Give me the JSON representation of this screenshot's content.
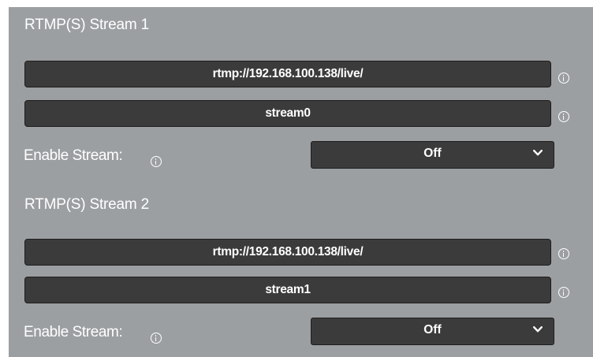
{
  "streams": [
    {
      "title": "RTMP(S) Stream 1",
      "url_value": "rtmp://192.168.100.138/live/",
      "key_value": "stream0",
      "enable_label": "Enable Stream:",
      "enable_value": "Off"
    },
    {
      "title": "RTMP(S) Stream 2",
      "url_value": "rtmp://192.168.100.138/live/",
      "key_value": "stream1",
      "enable_label": "Enable Stream:",
      "enable_value": "Off"
    }
  ],
  "icons": {
    "info": "info-icon",
    "dropdown": "chevron-down-icon"
  },
  "colors": {
    "panel_bg": "#9c9fa2",
    "field_bg": "#3b3b3b",
    "text": "#ffffff"
  }
}
